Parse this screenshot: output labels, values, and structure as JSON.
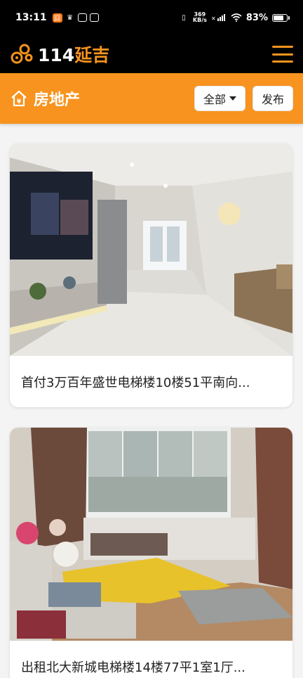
{
  "status_bar": {
    "time": "13:11",
    "net_speed_value": "369",
    "net_speed_unit": "KB/s",
    "battery_percent": "83%",
    "battery_level": 0.83
  },
  "header": {
    "logo_number": "114",
    "logo_city": "延吉"
  },
  "section": {
    "title": "房地产",
    "filter_label": "全部",
    "publish_label": "发布"
  },
  "listings": [
    {
      "title": "首付3万百年盛世电梯楼10楼51平南向..."
    },
    {
      "title": "出租北大新城电梯楼14楼77平1室1厅..."
    }
  ],
  "colors": {
    "accent": "#f7931e",
    "header_bg": "#000000",
    "page_bg": "#f4f4f4"
  }
}
